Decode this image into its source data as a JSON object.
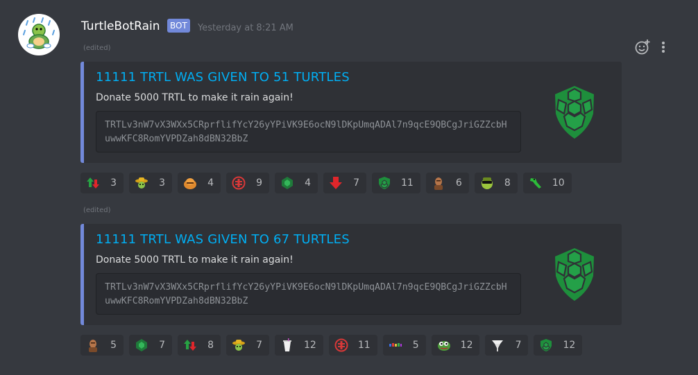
{
  "message": {
    "author": "TurtleBotRain",
    "bot_tag": "BOT",
    "timestamp": "Yesterday at 8:21 AM"
  },
  "colors": {
    "background": "#36393f",
    "embed_bg": "#2f3136",
    "embed_border": "#7289da",
    "title_link": "#00aff4",
    "turtle_green": "#1e8f3c"
  },
  "icons": {
    "add_reaction": "add-reaction-icon",
    "more": "more-options-icon"
  },
  "embeds": [
    {
      "edited": "(edited)",
      "title": "11111 TRTL WAS GIVEN TO 51 TURTLES",
      "description": "Donate 5000 TRTL to make it rain again!",
      "address": "TRTLv3nW7vX3WXx5CRprflifYcY26yYPiVK9E6ocN9lDKpUmqADAl7n9qcE9QBCgJriGZZcbHuwwKFC8RomYVPDZah8dBN32BbZ",
      "reactions": [
        {
          "emoji": "green-red-arrows",
          "count": "3"
        },
        {
          "emoji": "sombrero-turtle",
          "count": "3"
        },
        {
          "emoji": "orange-blob",
          "count": "4"
        },
        {
          "emoji": "red-turtle-logo",
          "count": "9"
        },
        {
          "emoji": "green-turtle-logo",
          "count": "4"
        },
        {
          "emoji": "red-down-arrow",
          "count": "7"
        },
        {
          "emoji": "green-shell",
          "count": "11"
        },
        {
          "emoji": "person-face",
          "count": "6"
        },
        {
          "emoji": "sunglasses-turtle",
          "count": "8"
        },
        {
          "emoji": "green-dragon",
          "count": "10"
        }
      ]
    },
    {
      "edited": "(edited)",
      "title": "11111 TRTL WAS GIVEN TO 67 TURTLES",
      "description": "Donate 5000 TRTL to make it rain again!",
      "address": "TRTLv3nW7vX3WXx5CRprflifYcY26yYPiVK9E6ocN9lDKpUmqADAl7n9qcE9QBCgJriGZZcbHuwwKFC8RomYVPDZah8dBN32BbZ",
      "reactions": [
        {
          "emoji": "person-face",
          "count": "5"
        },
        {
          "emoji": "green-turtle-logo",
          "count": "7"
        },
        {
          "emoji": "green-red-arrows",
          "count": "8"
        },
        {
          "emoji": "sombrero-turtle",
          "count": "7"
        },
        {
          "emoji": "white-cup",
          "count": "12"
        },
        {
          "emoji": "red-turtle-logo",
          "count": "11"
        },
        {
          "emoji": "colorful-text",
          "count": "5"
        },
        {
          "emoji": "pepe-frog",
          "count": "12"
        },
        {
          "emoji": "white-tornado",
          "count": "7"
        },
        {
          "emoji": "green-shell",
          "count": "12"
        }
      ]
    }
  ]
}
